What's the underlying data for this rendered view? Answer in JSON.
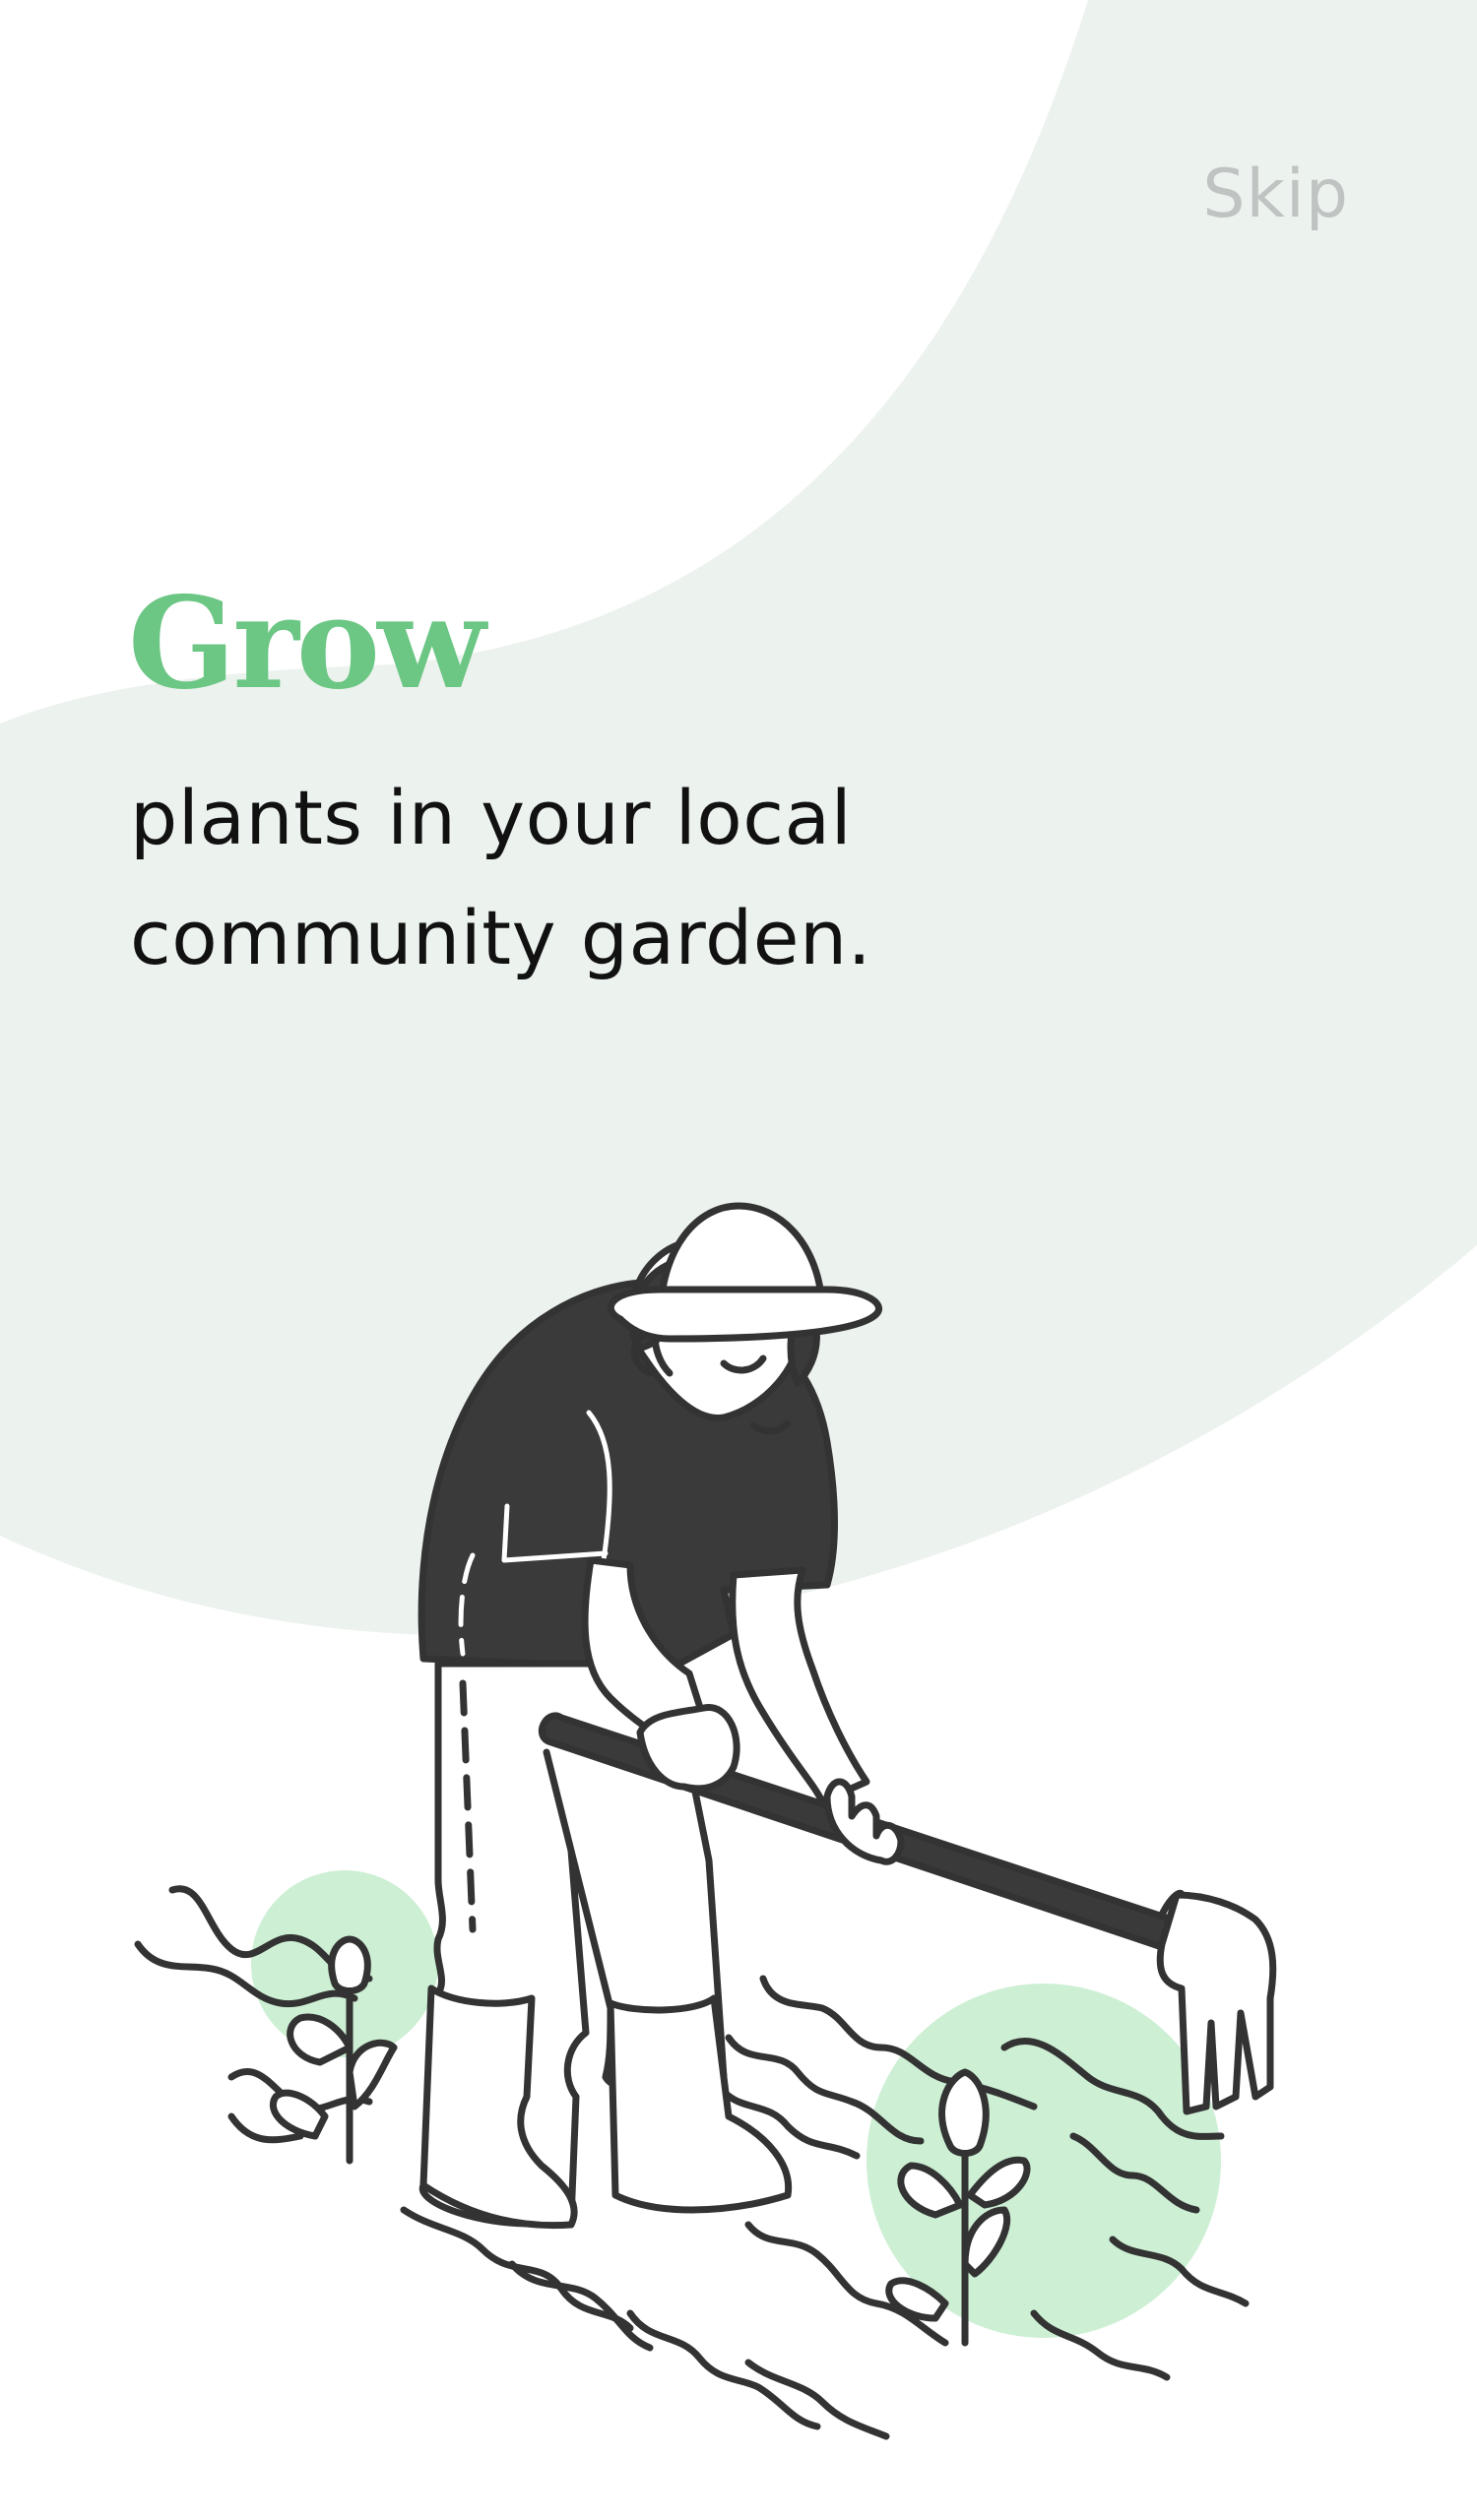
{
  "colors": {
    "background": "#ffffff",
    "blob": "#ecf2ee",
    "accent": "#6cc684",
    "accent_light": "#cdefd4",
    "skip_text": "#bfc3c1",
    "ink": "#333333"
  },
  "header": {
    "skip_label": "Skip"
  },
  "onboarding": {
    "headline": "Grow",
    "subtitle_line1": "plants in your local",
    "subtitle_line2": "community garden."
  },
  "illustration": {
    "icon": "gardener-with-hoe-illustration"
  }
}
